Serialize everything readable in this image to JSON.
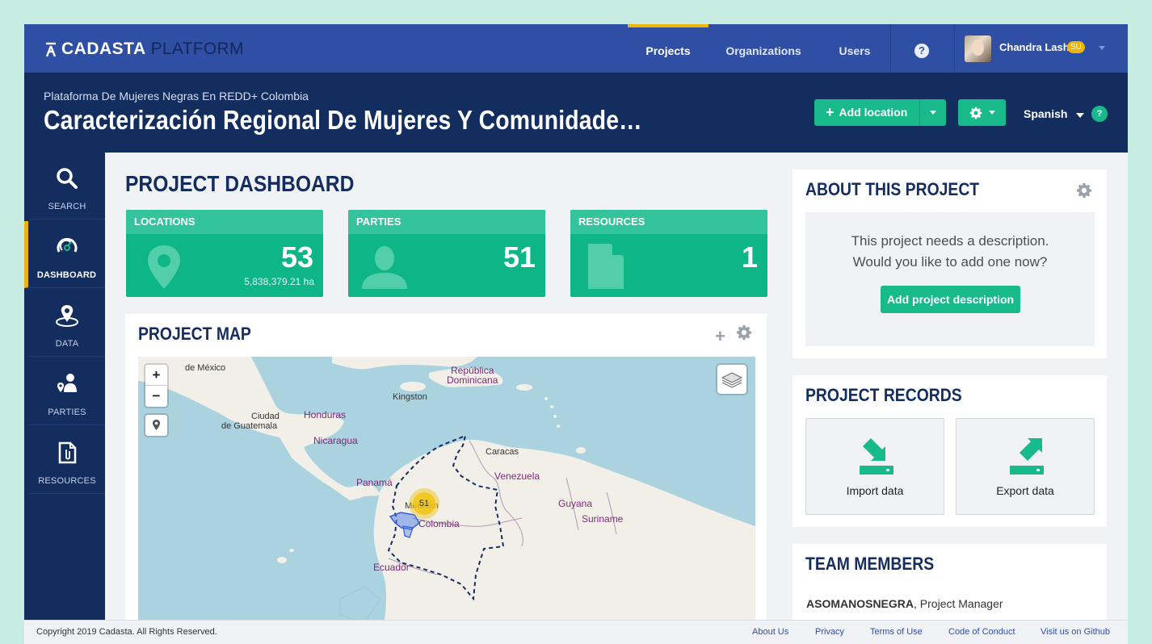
{
  "app": {
    "brand": "CADASTA",
    "platform": "PLATFORM"
  },
  "topnav": {
    "items": [
      {
        "label": "Projects",
        "active": true
      },
      {
        "label": "Organizations"
      },
      {
        "label": "Users"
      }
    ],
    "help_icon": "question-circle-icon",
    "user": {
      "name": "Chandra Lash",
      "badge": "SU"
    }
  },
  "header": {
    "organization": "Plataforma De Mujeres Negras En REDD+ Colombia",
    "project_title": "Caracterización Regional De Mujeres Y Comunidade…",
    "add_location_label": "Add location",
    "language": "Spanish",
    "language_help": "?"
  },
  "sidebar": {
    "items": [
      {
        "label": "SEARCH",
        "icon": "search-icon"
      },
      {
        "label": "DASHBOARD",
        "icon": "dashboard-icon",
        "active": true
      },
      {
        "label": "DATA",
        "icon": "map-pin-icon"
      },
      {
        "label": "PARTIES",
        "icon": "person-pin-icon"
      },
      {
        "label": "RESOURCES",
        "icon": "document-icon"
      }
    ]
  },
  "dashboard": {
    "title": "PROJECT DASHBOARD",
    "stats": [
      {
        "label": "LOCATIONS",
        "value": "53",
        "sub": "5,838,379.21 ha",
        "icon": "location-pin-icon"
      },
      {
        "label": "PARTIES",
        "value": "51",
        "icon": "person-icon"
      },
      {
        "label": "RESOURCES",
        "value": "1",
        "icon": "document-icon"
      }
    ]
  },
  "map": {
    "title": "PROJECT MAP",
    "zoom_in": "+",
    "zoom_out": "−",
    "cluster_count": "51",
    "labels": {
      "mexico": "de México",
      "kingston": "Kingston",
      "republica": "República",
      "dominicana": "Dominicana",
      "honduras": "Honduras",
      "ciudad": "Ciudad",
      "guatemala": "de Guatemala",
      "nicaragua": "Nicaragua",
      "caracas": "Caracas",
      "venezuela": "Venezuela",
      "panama": "Panamá",
      "medellin": "Medellín",
      "colombia": "Colombia",
      "guyana": "Guyana",
      "suriname": "Suriname",
      "ecuador": "Ecuador"
    }
  },
  "about": {
    "title": "ABOUT THIS PROJECT",
    "line1": "This project needs a description.",
    "line2": "Would you like to add one now?",
    "button": "Add project description"
  },
  "records": {
    "title": "PROJECT RECORDS",
    "import": "Import data",
    "export": "Export data"
  },
  "team": {
    "title": "TEAM MEMBERS",
    "members": [
      {
        "name": "ASOMANOSNEGRA",
        "role": ", Project Manager"
      }
    ]
  },
  "footer": {
    "copyright": "Copyright 2019 Cadasta. All Rights Reserved.",
    "links": [
      "About Us",
      "Privacy",
      "Terms of Use",
      "Code of Conduct",
      "Visit us on Github"
    ]
  },
  "colors": {
    "nav": "#2f4fa4",
    "header": "#142d5f",
    "accent": "#f0b400",
    "green": "#0eb587"
  }
}
